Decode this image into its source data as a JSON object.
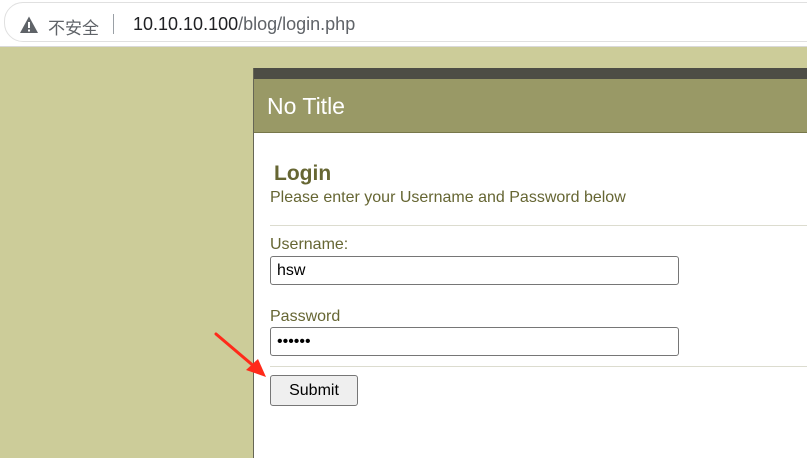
{
  "browser": {
    "security_label": "不安全",
    "url_host": "10.10.10.100",
    "url_path": "/blog/login.php"
  },
  "site": {
    "title": "No Title"
  },
  "login": {
    "heading": "Login",
    "instructions": "Please enter your Username and Password below",
    "username_label": "Username:",
    "username_value": "hsw",
    "password_label": "Password",
    "password_value": "hswhsw",
    "submit_label": "Submit"
  },
  "colors": {
    "page_background": "#cccc99",
    "header_background": "#999966",
    "topbar": "#4d4d45",
    "text_accent": "#666633",
    "annotation_arrow": "#ff2a1a"
  },
  "icons": {
    "security": "warning-triangle-icon",
    "annotation": "red-arrow-icon"
  }
}
